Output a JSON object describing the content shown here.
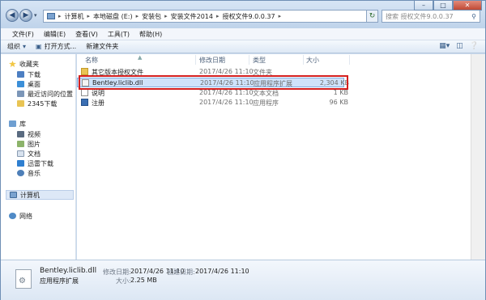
{
  "address": {
    "crumbs": [
      "计算机",
      "本地磁盘 (E:)",
      "安装包",
      "安装文件2014",
      "授权文件9.0.0.37"
    ]
  },
  "search": {
    "placeholder": "搜索 授权文件9.0.0.37"
  },
  "menu": [
    "文件(F)",
    "编辑(E)",
    "查看(V)",
    "工具(T)",
    "帮助(H)"
  ],
  "toolbar": {
    "organize": "组织",
    "open_with": "打开方式...",
    "new_folder": "新建文件夹"
  },
  "nav": {
    "favorites": "收藏夹",
    "downloads": "下载",
    "desktop": "桌面",
    "recent": "最近访问的位置",
    "downloads2345": "2345下载",
    "libraries": "库",
    "videos": "视频",
    "pictures": "图片",
    "documents": "文档",
    "thunder": "迅雷下载",
    "music": "音乐",
    "computer": "计算机",
    "network": "网络"
  },
  "columns": {
    "name": "名称",
    "modified": "修改日期",
    "type": "类型",
    "size": "大小"
  },
  "files": [
    {
      "name": "其它版本授权文件",
      "modified": "2017/4/26 11:10",
      "type": "文件夹",
      "size": "",
      "icon": "folder-icon",
      "selected": false
    },
    {
      "name": "Bentley.liclib.dll",
      "modified": "2017/4/26 11:10",
      "type": "应用程序扩展",
      "size": "2,304 KB",
      "icon": "dll-file-icon",
      "selected": true
    },
    {
      "name": "说明",
      "modified": "2017/4/26 11:10",
      "type": "文本文档",
      "size": "1 KB",
      "icon": "text-file-icon",
      "selected": false
    },
    {
      "name": "注册",
      "modified": "2017/4/26 11:10",
      "type": "应用程序",
      "size": "96 KB",
      "icon": "exe-file-icon",
      "selected": false
    }
  ],
  "details": {
    "name": "Bentley.liclib.dll",
    "modified_label": "修改日期:",
    "modified_value": "2017/4/26 11:10",
    "created_label": "创建日期:",
    "created_value": "2017/4/26 11:10",
    "type": "应用程序扩展",
    "size_label": "大小:",
    "size_value": "2.25 MB"
  },
  "colors": {
    "accent": "#cfe3fb",
    "highlight": "#d42020",
    "folder": "#e9c454"
  }
}
